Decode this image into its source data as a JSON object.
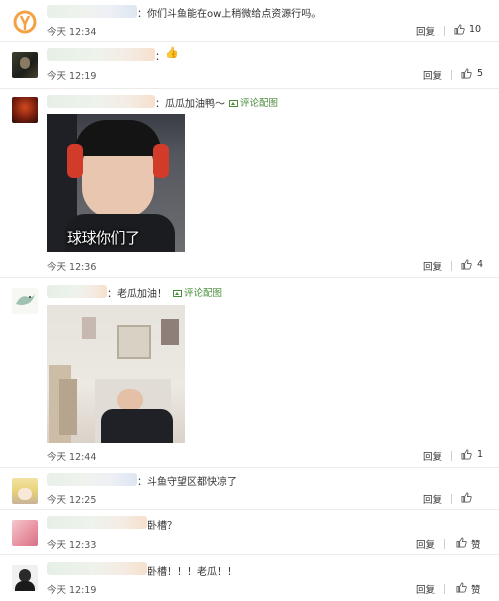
{
  "comments": [
    {
      "text": "：你们斗鱼能在ow上稍微给点资源行吗。",
      "time": "今天 12:34",
      "reply": "回复",
      "likes": "10",
      "avatar": "overwatch-logo-icon"
    },
    {
      "text": "：",
      "time": "今天 12:19",
      "reply": "回复",
      "likes": "5",
      "avatar": "user-avatar"
    },
    {
      "text": "：瓜瓜加油鸭～",
      "pic_link": "评论配图",
      "time": "今天 12:36",
      "reply": "回复",
      "likes": "4",
      "caption": "球球你们了",
      "avatar": "user-avatar"
    },
    {
      "text": "：老瓜加油！",
      "pic_link": "评论配图",
      "time": "今天 12:44",
      "reply": "回复",
      "likes": "1",
      "avatar": "bird-avatar"
    },
    {
      "text": "：斗鱼守望区都快凉了",
      "time": "今天 12:25",
      "reply": "回复",
      "likes": "",
      "avatar": "anime-avatar"
    },
    {
      "text": "卧槽？",
      "time": "今天 12:33",
      "reply": "回复",
      "likes": "赞",
      "avatar": "pink-avatar"
    },
    {
      "text": "卧槽！！！老瓜！！",
      "time": "今天 12:19",
      "reply": "回复",
      "likes": "赞",
      "avatar": "user-avatar"
    }
  ],
  "colors": {
    "link_green": "#4a8d3b",
    "divider": "#ebebeb",
    "text": "#333333"
  }
}
